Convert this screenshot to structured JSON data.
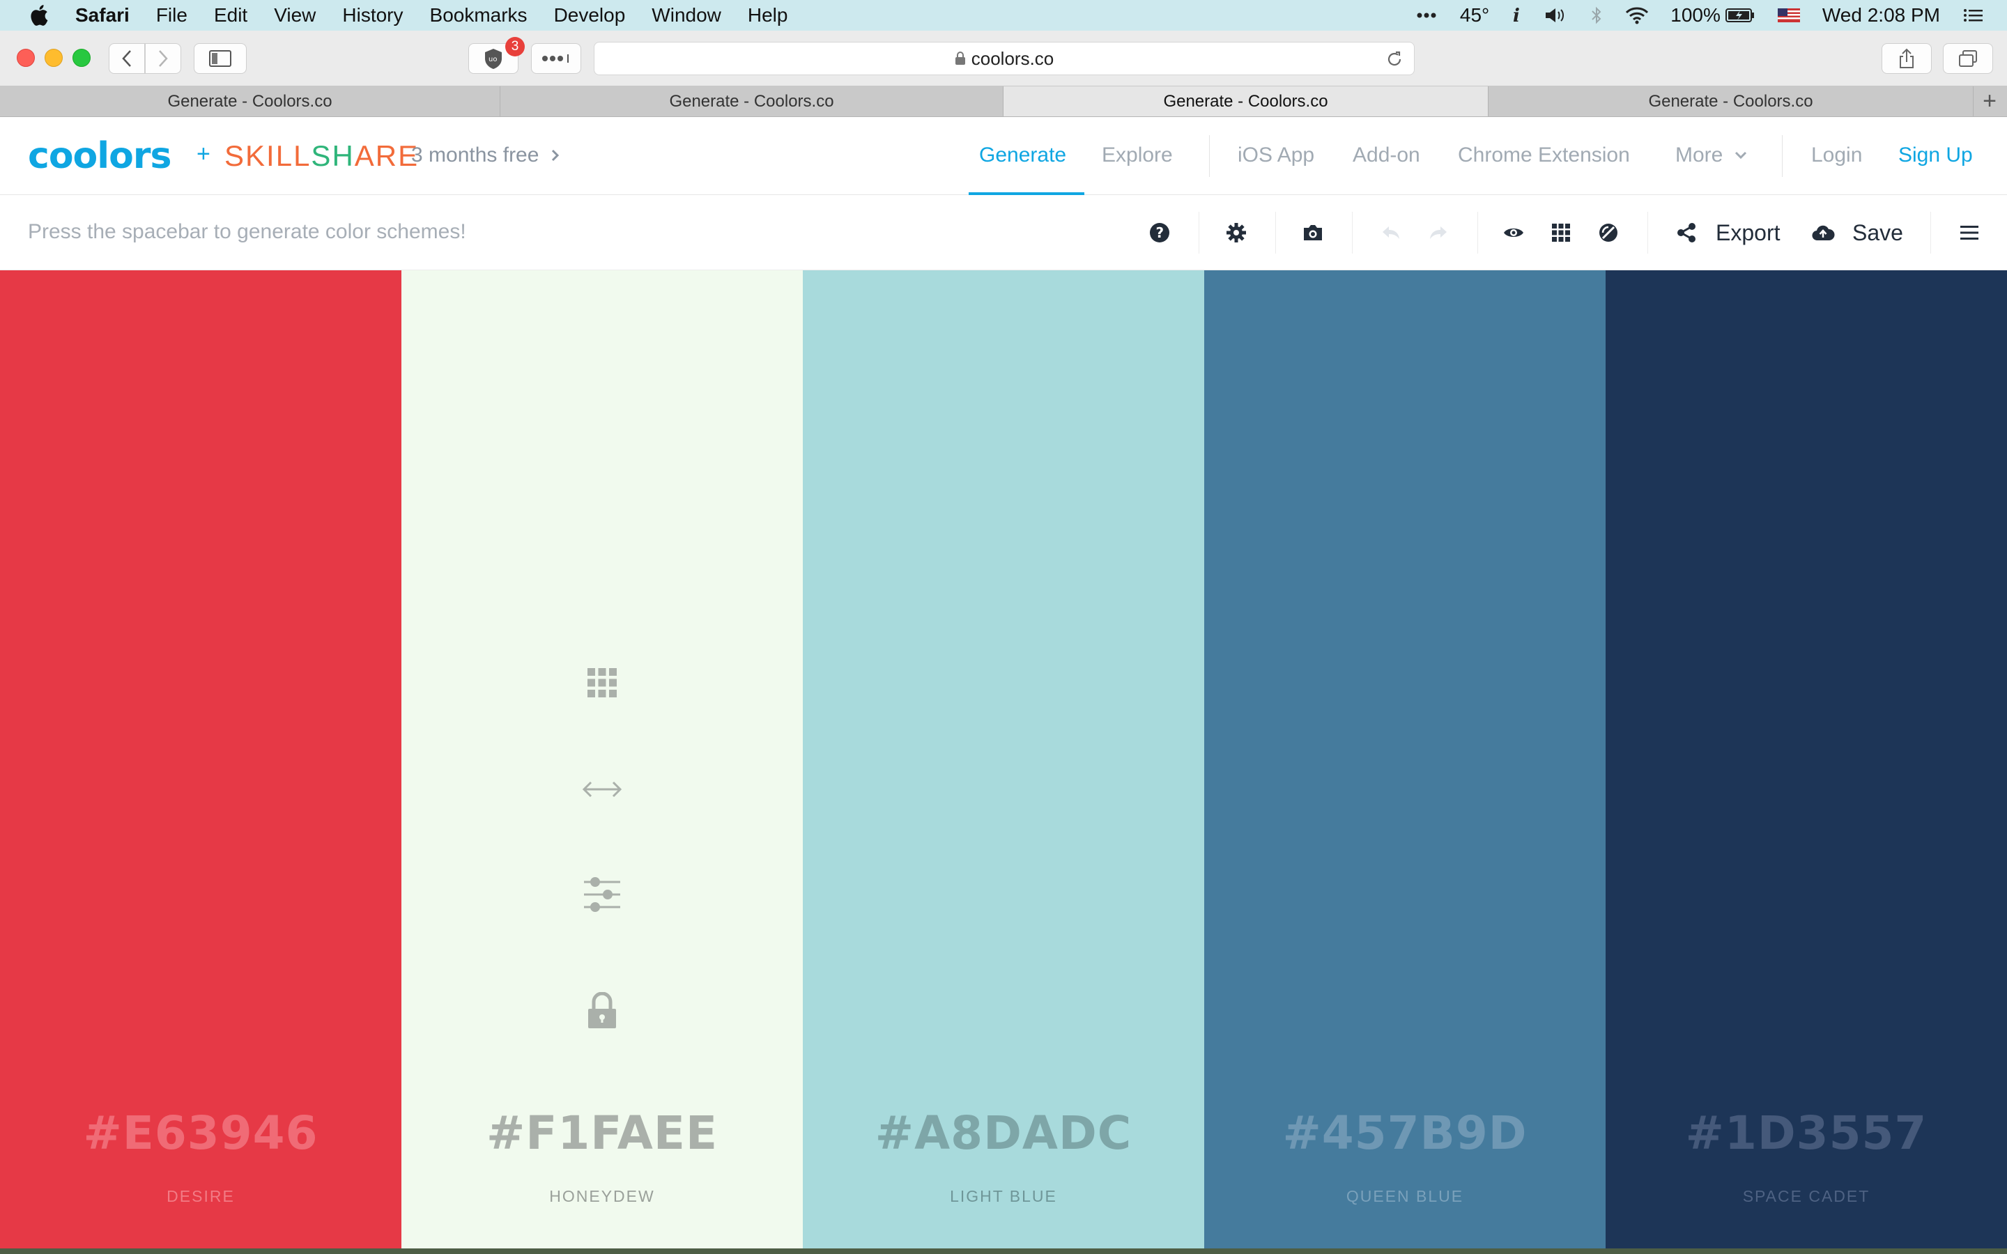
{
  "menubar": {
    "app_name": "Safari",
    "menus": [
      "File",
      "Edit",
      "View",
      "History",
      "Bookmarks",
      "Develop",
      "Window",
      "Help"
    ],
    "temperature": "45°",
    "battery": "100%",
    "clock": "Wed 2:08 PM"
  },
  "browser": {
    "url": "coolors.co",
    "extension_badge": "3",
    "tabs": [
      {
        "title": "Generate - Coolors.co",
        "active": false
      },
      {
        "title": "Generate - Coolors.co",
        "active": false
      },
      {
        "title": "Generate - Coolors.co",
        "active": true
      },
      {
        "title": "Generate - Coolors.co",
        "active": false
      }
    ]
  },
  "nav": {
    "logo": "coolors",
    "plus": "+",
    "partner": "SKILLSHARE",
    "promo": "3 months free",
    "links": {
      "generate": "Generate",
      "explore": "Explore",
      "ios": "iOS App",
      "addon": "Add-on",
      "chrome": "Chrome Extension",
      "more": "More",
      "login": "Login",
      "signup": "Sign Up"
    }
  },
  "toolbar": {
    "hint": "Press the spacebar to generate color schemes!",
    "export": "Export",
    "save": "Save"
  },
  "palette": [
    {
      "hex": "#E63946",
      "name": "DESIRE",
      "color": "#E63946",
      "hex_color": "#f06b76",
      "name_color": "#f27b85"
    },
    {
      "hex": "#F1FAEE",
      "name": "HONEYDEW",
      "color": "#F1FAEE",
      "hex_color": "#aab0aa",
      "name_color": "#9aa09a"
    },
    {
      "hex": "#A8DADC",
      "name": "LIGHT BLUE",
      "color": "#A8DADC",
      "hex_color": "#7ea6a8",
      "name_color": "#6f9698"
    },
    {
      "hex": "#457B9D",
      "name": "QUEEN BLUE",
      "color": "#457B9D",
      "hex_color": "#6f98b4",
      "name_color": "#7aa1bb"
    },
    {
      "hex": "#1D3557",
      "name": "SPACE CADET",
      "color": "#1D3557",
      "hex_color": "#45597a",
      "name_color": "#4e6283"
    }
  ],
  "colors": {
    "accent": "#0fa6e2",
    "skillshare_green": "#2fb57a",
    "skillshare_orange": "#f26b3a"
  }
}
